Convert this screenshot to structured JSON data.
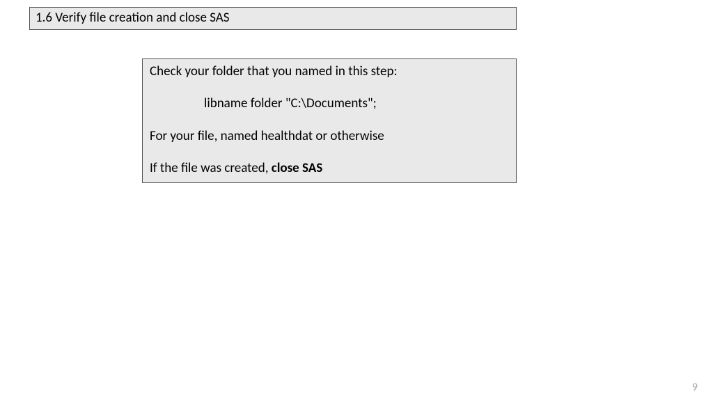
{
  "header": {
    "title": "1.6 Verify file creation and close SAS"
  },
  "body": {
    "line1": "Check your folder that you named in this step:",
    "code": "libname folder \"C:\\Documents\";",
    "line2": "For your file, named healthdat or otherwise",
    "line3_prefix": "If the file was created, ",
    "line3_bold": "close SAS"
  },
  "page_number": "9"
}
